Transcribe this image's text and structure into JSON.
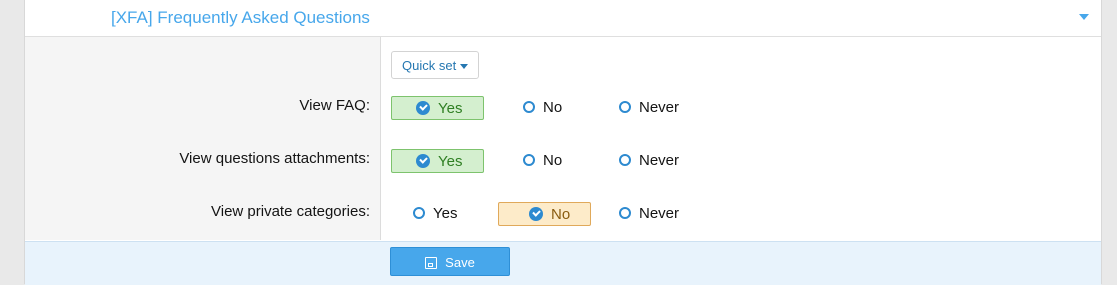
{
  "header": {
    "title": "[XFA] Frequently Asked Questions"
  },
  "quickset": {
    "label": "Quick set"
  },
  "rows": [
    {
      "label": "View FAQ:",
      "options": [
        "Yes",
        "No",
        "Never"
      ],
      "selected": "Yes"
    },
    {
      "label": "View questions attachments:",
      "options": [
        "Yes",
        "No",
        "Never"
      ],
      "selected": "Yes"
    },
    {
      "label": "View private categories:",
      "options": [
        "Yes",
        "No",
        "Never"
      ],
      "selected": "No"
    }
  ],
  "footer": {
    "save_label": "Save"
  },
  "colors": {
    "accent": "#47a7eb",
    "yes_selected_bg": "#d4efcf",
    "no_selected_bg": "#fdebc9"
  }
}
